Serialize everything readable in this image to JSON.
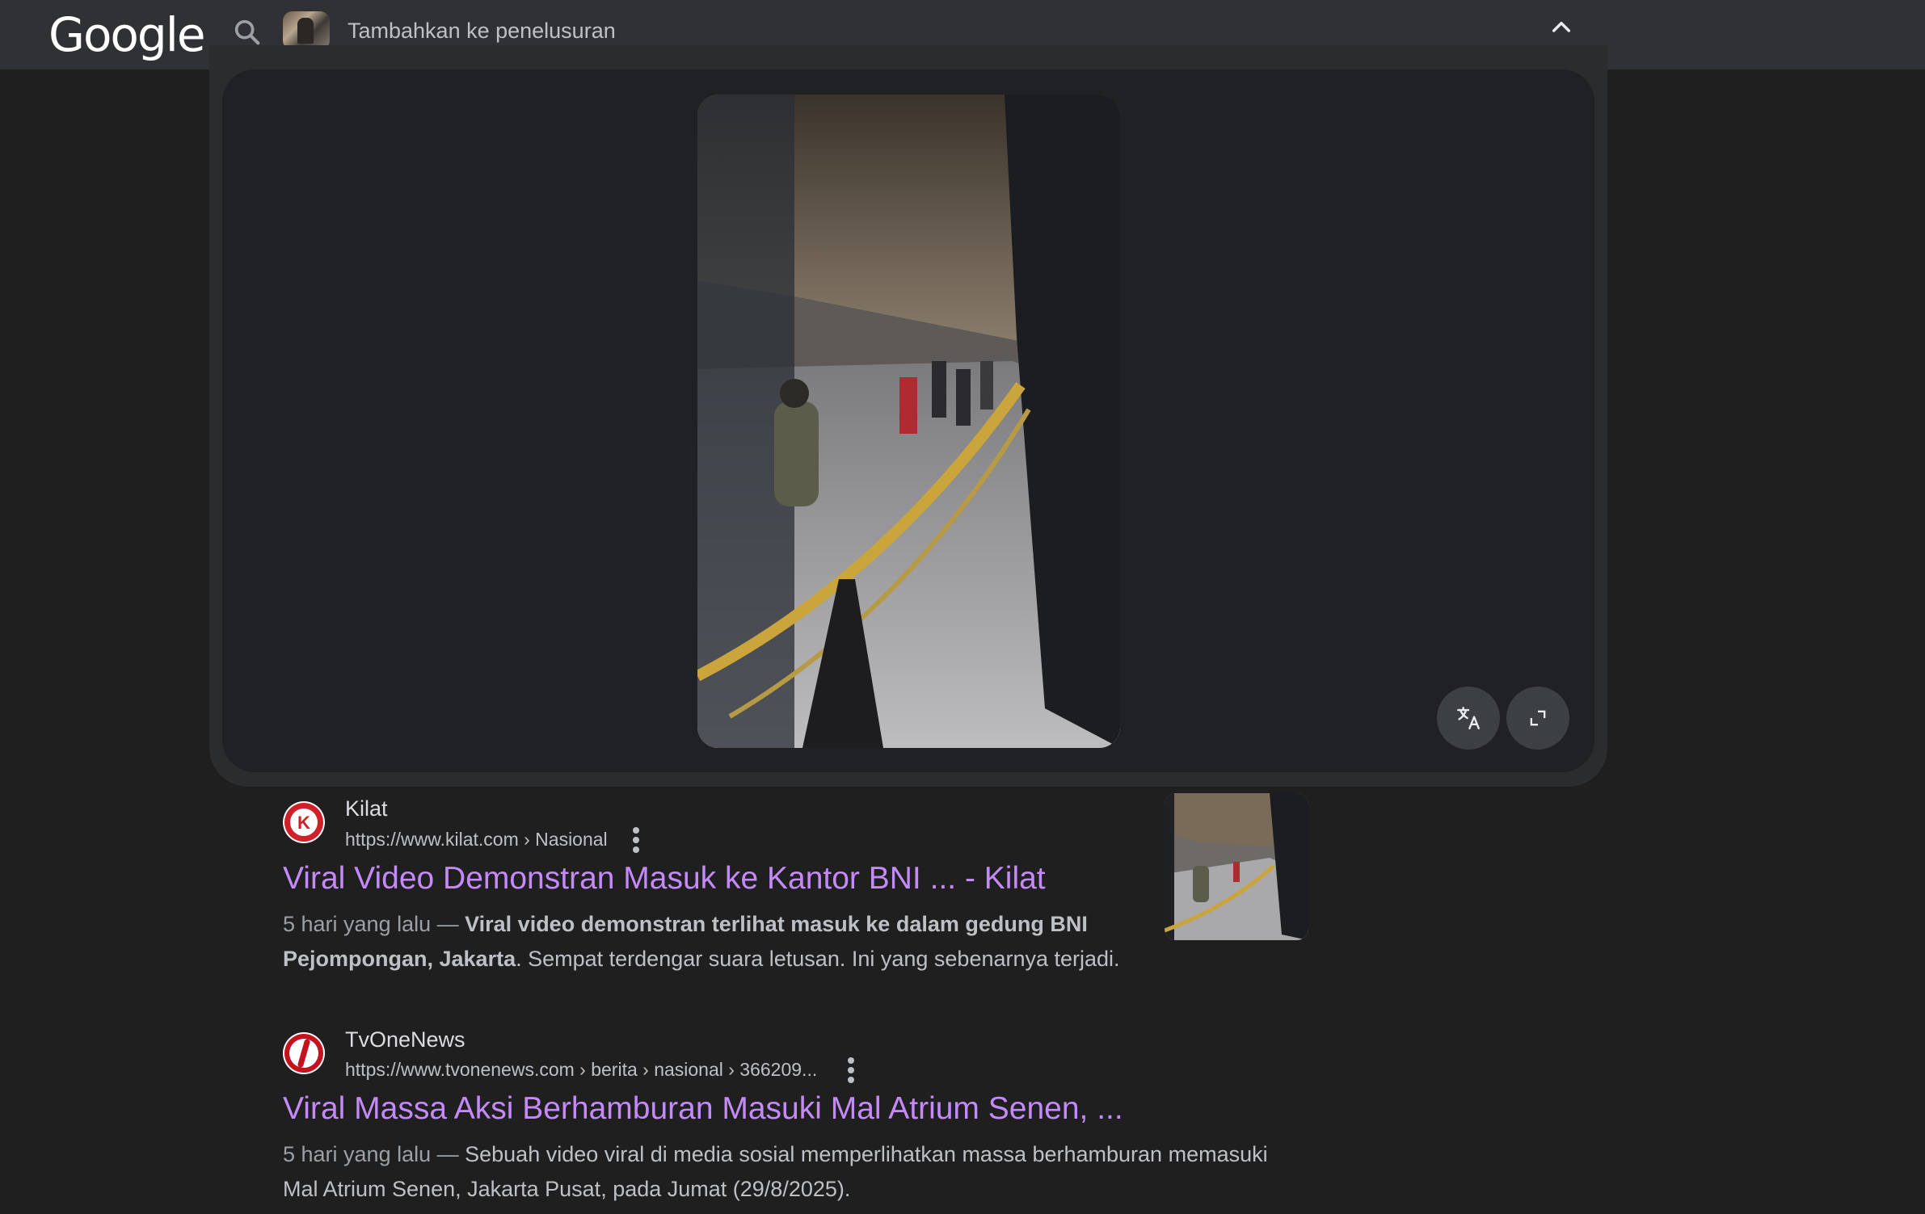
{
  "header": {
    "logo": "Google",
    "search_placeholder": "Tambahkan ke penelusuran"
  },
  "results": [
    {
      "site": "Kilat",
      "url": "https://www.kilat.com › Nasional",
      "title": "Viral Video Demonstran Masuk ke Kantor BNI ... - Kilat",
      "date": "5 hari yang lalu — ",
      "snippet_bold": "Viral video demonstran terlihat masuk ke dalam gedung BNI Pejompongan, Jakarta",
      "snippet_rest": ". Sempat terdengar suara letusan. Ini yang sebenarnya terjadi."
    },
    {
      "site": "TvOneNews",
      "url": "https://www.tvonenews.com › berita › nasional › 366209...",
      "title": "Viral Massa Aksi Berhamburan Masuki Mal Atrium Senen, ...",
      "date": "5 hari yang lalu — ",
      "snippet": "Sebuah video viral di media sosial memperlihatkan massa berhamburan memasuki Mal Atrium Senen, Jakarta Pusat, pada Jumat (29/8/2025)."
    }
  ],
  "colors": {
    "background": "#1f1f1f",
    "topbar": "#303134",
    "link": "#c58af9"
  }
}
